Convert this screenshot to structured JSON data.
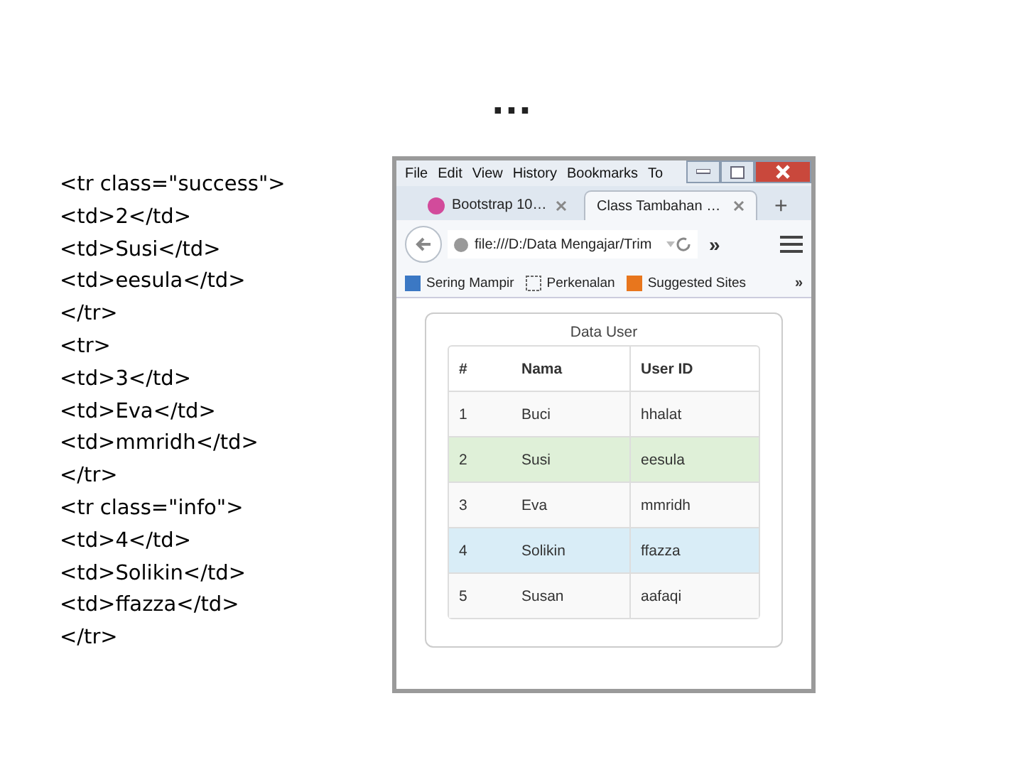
{
  "slide": {
    "title": "…",
    "code_lines": [
      "<tr class=\"success\">",
      "<td>2</td>",
      "<td>Susi</td>",
      "<td>eesula</td>",
      "</tr>",
      "<tr>",
      "<td>3</td>",
      "<td>Eva</td>",
      "<td>mmridh</td>",
      "</tr>",
      "<tr class=\"info\">",
      "<td>4</td>",
      "<td>Solikin</td>",
      "<td>ffazza</td>",
      "</tr>"
    ]
  },
  "browser": {
    "menu": [
      "File",
      "Edit",
      "View",
      "History",
      "Bookmarks",
      "To"
    ],
    "tabs": [
      {
        "label": "Bootstrap 10…",
        "selected": false
      },
      {
        "label": "Class Tambahan …",
        "selected": true
      }
    ],
    "new_tab": "+",
    "url": "file:///D:/Data Mengajar/Trim",
    "overflow": "»",
    "bookmarks_overflow": "»",
    "bookmarks": [
      "Sering Mampir",
      "Perkenalan",
      "Suggested Sites"
    ],
    "table": {
      "caption": "Data User",
      "columns": [
        "#",
        "Nama",
        "User ID"
      ],
      "rows": [
        {
          "cells": [
            "1",
            "Buci",
            "hhalat"
          ],
          "color": "#f9f9f9"
        },
        {
          "cells": [
            "2",
            "Susi",
            "eesula"
          ],
          "color": "#dff0d8"
        },
        {
          "cells": [
            "3",
            "Eva",
            "mmridh"
          ],
          "color": "#f9f9f9"
        },
        {
          "cells": [
            "4",
            "Solikin",
            "ffazza"
          ],
          "color": "#d9edf7"
        },
        {
          "cells": [
            "5",
            "Susan",
            "aafaqi"
          ],
          "color": "#f9f9f9"
        }
      ]
    }
  }
}
